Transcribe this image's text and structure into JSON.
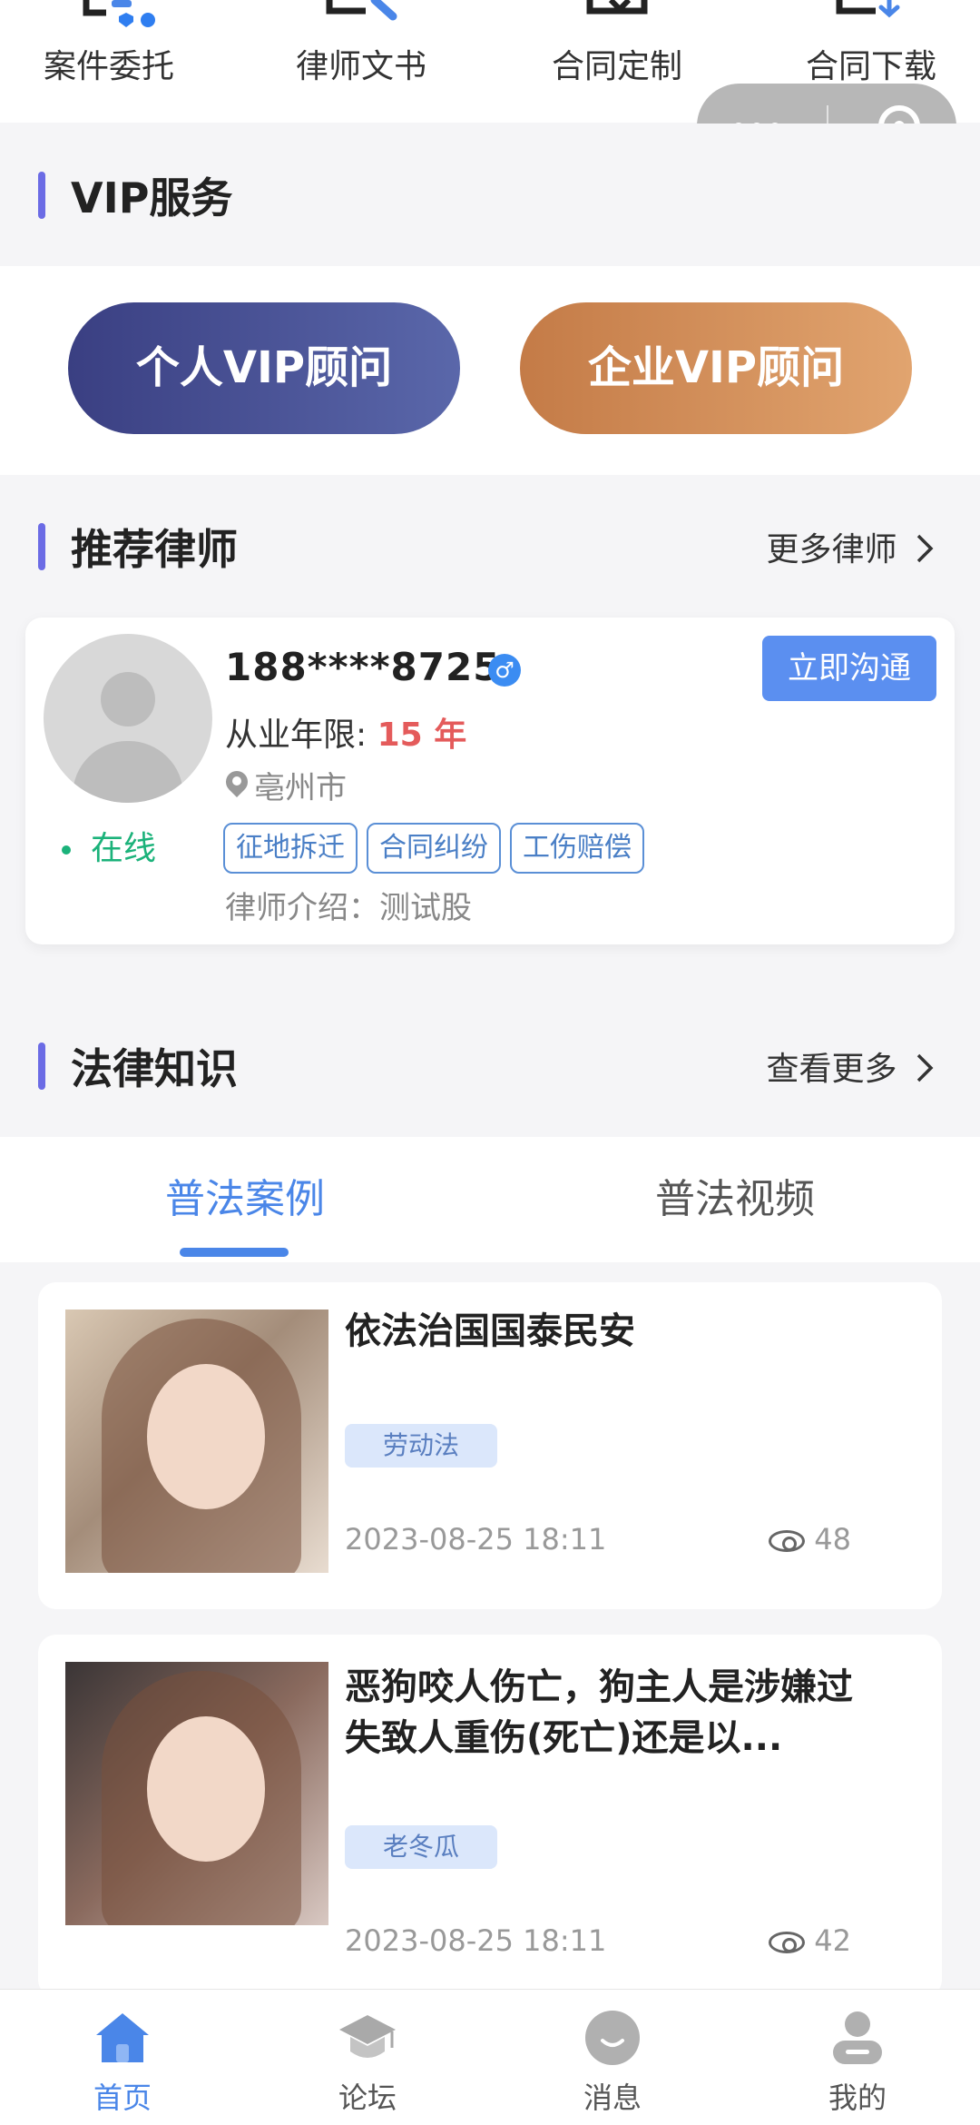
{
  "services": [
    {
      "label": "案件委托",
      "icon": "case-entrust-icon"
    },
    {
      "label": "律师文书",
      "icon": "lawyer-document-icon"
    },
    {
      "label": "合同定制",
      "icon": "contract-custom-icon"
    },
    {
      "label": "合同下载",
      "icon": "contract-download-icon"
    }
  ],
  "vip": {
    "section_title": "VIP服务",
    "personal_label": "个人VIP顾问",
    "company_label": "企业VIP顾问"
  },
  "lawyers": {
    "section_title": "推荐律师",
    "more_label": "更多律师",
    "card": {
      "phone": "188****8725",
      "gender_symbol": "♂",
      "years_label": "从业年限:",
      "years_value": "15 年",
      "city": "亳州市",
      "status": "在线",
      "tags": [
        "征地拆迁",
        "合同纠纷",
        "工伤赔偿"
      ],
      "intro": "律师介绍：测试股",
      "chat_label": "立即沟通"
    }
  },
  "knowledge": {
    "section_title": "法律知识",
    "more_label": "查看更多",
    "tabs": [
      {
        "label": "普法案例",
        "active": true
      },
      {
        "label": "普法视频",
        "active": false
      }
    ],
    "articles": [
      {
        "title": "依法治国国泰民安",
        "tag": "劳动法",
        "date": "2023-08-25 18:11",
        "views": "48"
      },
      {
        "title": "恶狗咬人伤亡，狗主人是涉嫌过失致人重伤(死亡)还是以...",
        "tag": "老冬瓜",
        "date": "2023-08-25 18:11",
        "views": "42"
      }
    ]
  },
  "nav": [
    {
      "label": "首页",
      "icon": "home-icon",
      "active": true
    },
    {
      "label": "论坛",
      "icon": "forum-icon",
      "active": false
    },
    {
      "label": "消息",
      "icon": "message-icon",
      "active": false
    },
    {
      "label": "我的",
      "icon": "profile-icon",
      "active": false
    }
  ],
  "colors": {
    "accent": "#4a86e8",
    "section_bar": "#6b6be5",
    "online": "#1bb27a",
    "years": "#e45b5b",
    "vip_personal": "#3a3f82",
    "vip_company": "#d08a55"
  }
}
